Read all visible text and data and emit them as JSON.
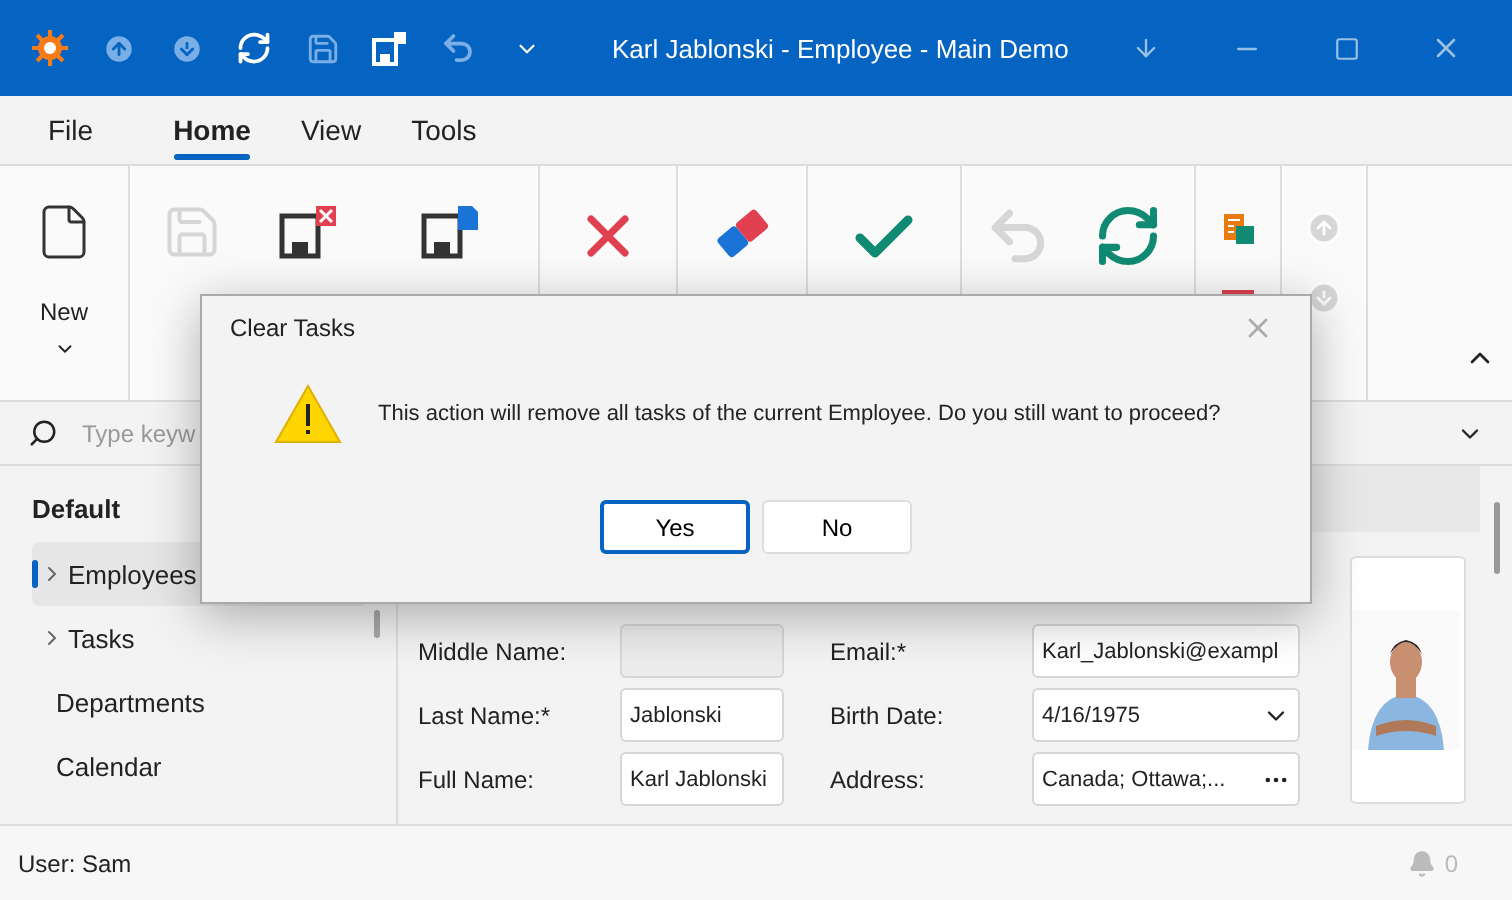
{
  "window": {
    "title": "Karl Jablonski - Employee - Main Demo"
  },
  "menu_tabs": [
    {
      "label": "File",
      "selected": false
    },
    {
      "label": "Home",
      "selected": true
    },
    {
      "label": "View",
      "selected": false
    },
    {
      "label": "Tools",
      "selected": false
    }
  ],
  "ribbon": {
    "groups": [
      [
        {
          "label": "New",
          "disabled": false
        }
      ],
      [
        {
          "disabled": true
        },
        {
          "disabled": false
        },
        {
          "disabled": false
        }
      ],
      [
        {
          "disabled": false
        }
      ],
      [
        {
          "disabled": false
        }
      ],
      [
        {
          "disabled": false
        }
      ],
      [
        {
          "disabled": true
        },
        {
          "disabled": false
        }
      ],
      [
        {
          "disabled": false
        },
        {
          "disabled": false
        }
      ],
      [
        {
          "disabled": true
        },
        {
          "disabled": true
        }
      ]
    ]
  },
  "search": {
    "placeholder": "Type keyw"
  },
  "navigation": {
    "header": "Default",
    "items": [
      {
        "label": "Employees",
        "selected": true,
        "expandable": true
      },
      {
        "label": "Tasks",
        "selected": false,
        "expandable": true
      },
      {
        "label": "Departments",
        "selected": false,
        "expandable": false
      },
      {
        "label": "Calendar",
        "selected": false,
        "expandable": false
      }
    ]
  },
  "form": {
    "rows": [
      [
        {
          "label": "Middle Name:",
          "kind": "text",
          "disabled": true
        },
        {
          "label": "Email:*",
          "value": "Karl_Jablonski@exampl",
          "kind": "text",
          "disabled": false
        }
      ],
      [
        {
          "label": "Last Name:*",
          "value": "Jablonski",
          "kind": "text",
          "disabled": false
        },
        {
          "label": "Birth Date:",
          "value": "4/16/1975",
          "kind": "date",
          "disabled": false
        }
      ],
      [
        {
          "label": "Full Name:",
          "value": "Karl Jablonski",
          "kind": "text",
          "disabled": false
        },
        {
          "label": "Address:",
          "value": "Canada; Ottawa;...",
          "kind": "ellipsis",
          "disabled": false
        }
      ]
    ],
    "photo": {
      "kind": "picture"
    }
  },
  "status_bar": {
    "user": "User: Sam",
    "notifications": "0"
  },
  "dialog": {
    "title": "Clear Tasks",
    "message": "This action will remove all tasks of the current Employee. Do you still want to proceed?",
    "buttons": [
      {
        "label": "Yes",
        "selected": true
      },
      {
        "label": "No",
        "selected": false
      }
    ]
  }
}
